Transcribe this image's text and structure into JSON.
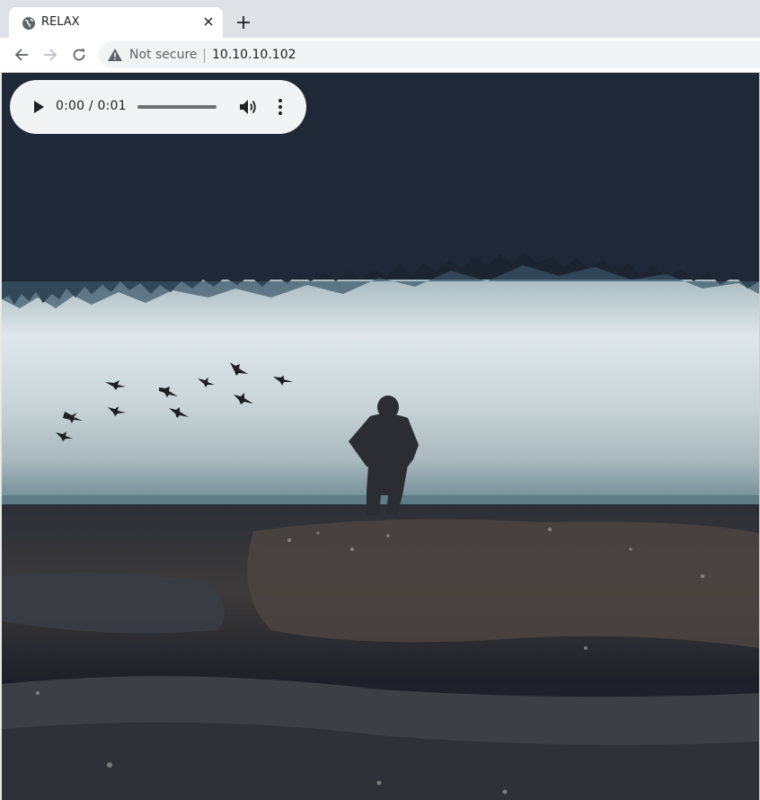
{
  "browser": {
    "tab": {
      "title": "RELAX",
      "icon": "globe-icon"
    },
    "toolbar": {
      "security_label": "Not secure",
      "url": "10.10.10.102"
    }
  },
  "audio_player": {
    "time_display": "0:00 / 0:01",
    "progress": 0,
    "state": "paused"
  },
  "colors": {
    "tab_bar": "#dee1e6",
    "omnibox": "#f1f3f4",
    "player": "#f1f3f4"
  }
}
